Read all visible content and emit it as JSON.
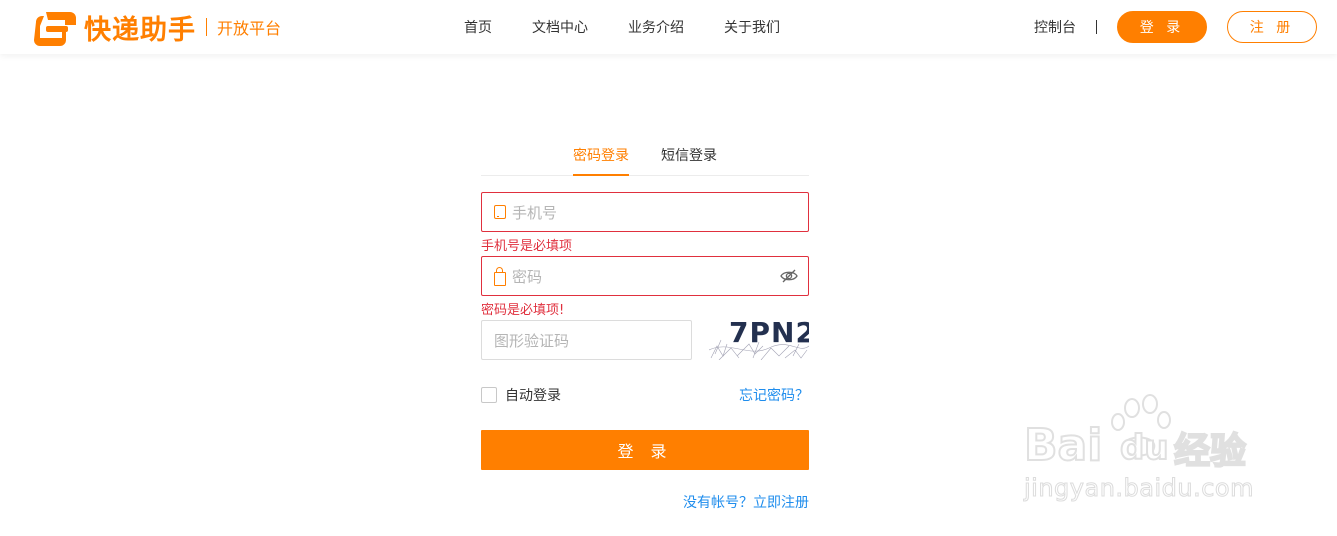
{
  "brand": {
    "name": "快递助手",
    "sub": "开放平台",
    "color": "#ff7f00"
  },
  "nav": {
    "items": [
      "首页",
      "文档中心",
      "业务介绍",
      "关于我们"
    ]
  },
  "header_actions": {
    "console": "控制台",
    "login": "登 录",
    "register": "注 册"
  },
  "login_form": {
    "tabs": [
      {
        "label": "密码登录",
        "active": true
      },
      {
        "label": "短信登录",
        "active": false
      }
    ],
    "phone": {
      "placeholder": "手机号",
      "error": "手机号是必填项"
    },
    "password": {
      "placeholder": "密码",
      "error": "密码是必填项!"
    },
    "captcha": {
      "placeholder": "图形验证码",
      "code": "7PN2"
    },
    "remember_label": "自动登录",
    "forgot_label": "忘记密码？",
    "submit_label": "登 录",
    "signup_label": "没有帐号？立即注册"
  },
  "watermark": {
    "brand": "Bai",
    "brand2": "du",
    "cn": "经验",
    "url": "jingyan.baidu.com"
  },
  "colors": {
    "accent": "#ff7f00",
    "error": "#e0303e",
    "link": "#1f8ded"
  },
  "icons": [
    "logo-mark-icon",
    "phone-icon",
    "lock-icon",
    "eye-off-icon",
    "paw-icon"
  ]
}
